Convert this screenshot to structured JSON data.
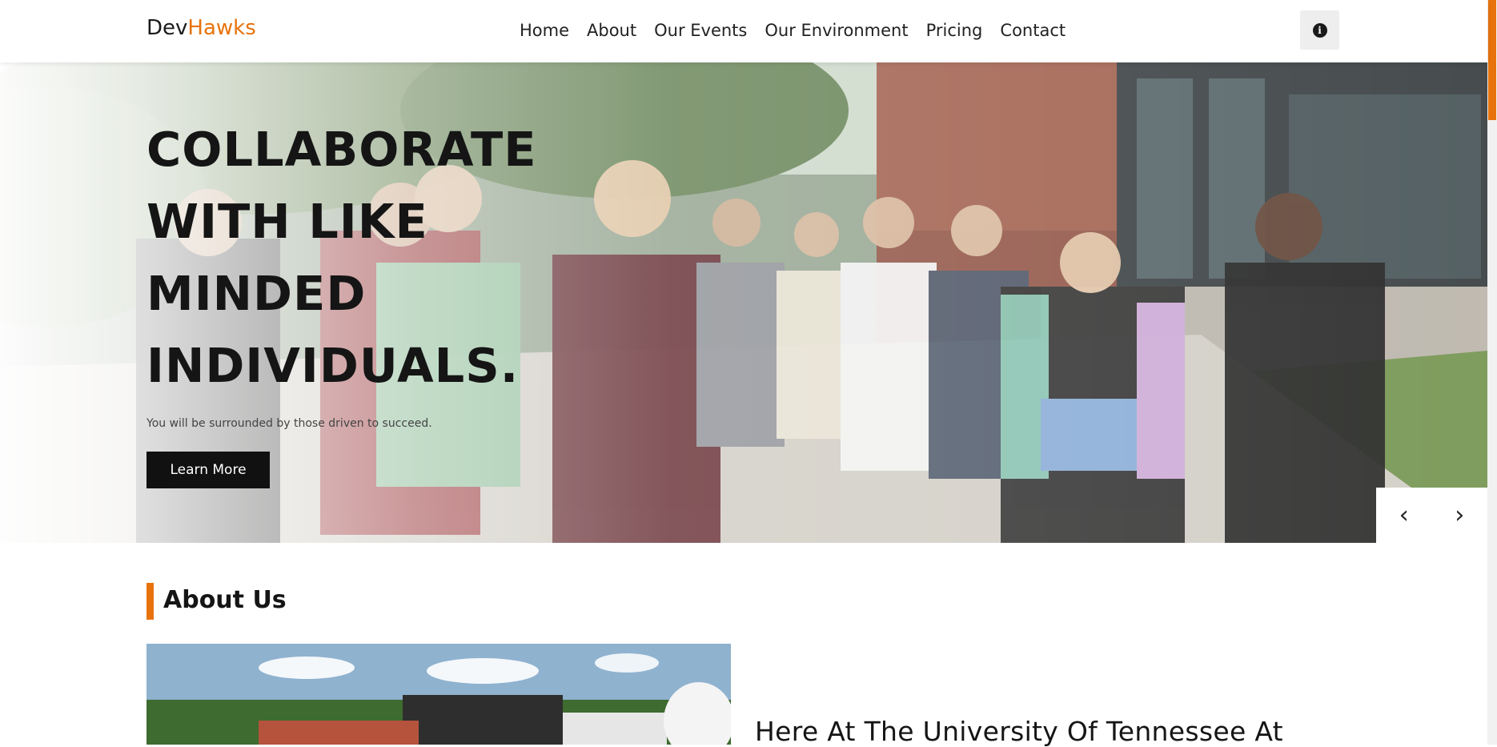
{
  "header": {
    "logo_part1": "Dev",
    "logo_part2": "Hawks",
    "nav": [
      "Home",
      "About",
      "Our Events",
      "Our Environment",
      "Pricing",
      "Contact"
    ],
    "info_icon": "i"
  },
  "hero": {
    "title": "COLLABORATE WITH LIKE MINDED INDIVIDUALS.",
    "subtitle": "You will be surrounded by those driven to succeed.",
    "button": "Learn More",
    "prev_icon": "‹",
    "next_icon": "›"
  },
  "about": {
    "section_title": "About Us",
    "heading": "Here At The University Of Tennessee At"
  },
  "colors": {
    "accent": "#e8730c",
    "dark": "#111111"
  }
}
